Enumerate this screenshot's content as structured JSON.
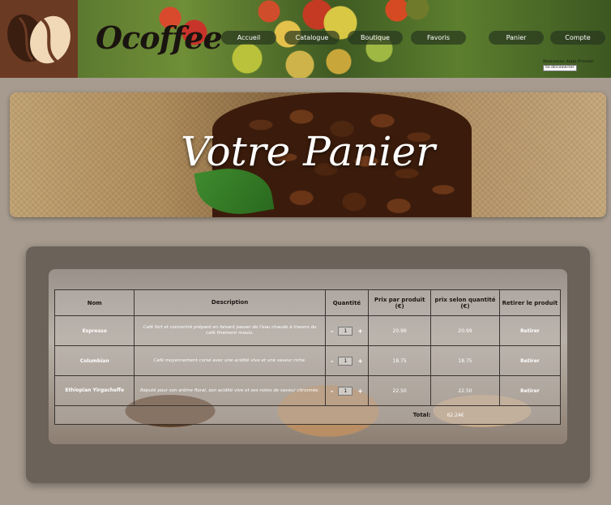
{
  "brand": {
    "name": "Ocoffee"
  },
  "nav": {
    "items": [
      {
        "label": "Accueil"
      },
      {
        "label": "Catalogue"
      },
      {
        "label": "Boutique"
      },
      {
        "label": "Favoris"
      },
      {
        "label": "Panier"
      },
      {
        "label": "Compte"
      }
    ]
  },
  "user": {
    "welcome": "Bienvenue Alain Provisir",
    "logout_label": "Se déconnecter"
  },
  "banner": {
    "title": "Votre Panier"
  },
  "cart": {
    "headers": {
      "name": "Nom",
      "description": "Description",
      "quantity": "Quantité",
      "unit_price": "Prix par produit (€)",
      "line_total": "prix selon quantité (€)",
      "remove": "Retirer le produit"
    },
    "rows": [
      {
        "name": "Espresso",
        "description": "Café fort et concentré préparé en faisant passer de l'eau chaude à travers du café finement moulu.",
        "quantity": "1",
        "unit_price": "20.99",
        "line_total": "20.99",
        "remove_label": "Retirer"
      },
      {
        "name": "Columbian",
        "description": "Café moyennement corsé avec une acidité vive et une saveur riche.",
        "quantity": "1",
        "unit_price": "18.75",
        "line_total": "18.75",
        "remove_label": "Retirer"
      },
      {
        "name": "Ethiopian Yirgacheffe",
        "description": "Réputé pour son arôme floral, son acidité vive et ses notes de saveur citronnée.",
        "quantity": "1",
        "unit_price": "22.50",
        "line_total": "22.50",
        "remove_label": "Retirer"
      }
    ],
    "minus_symbol": "-",
    "plus_symbol": "+",
    "total_label": "Total:",
    "total_value": "62.24€"
  }
}
